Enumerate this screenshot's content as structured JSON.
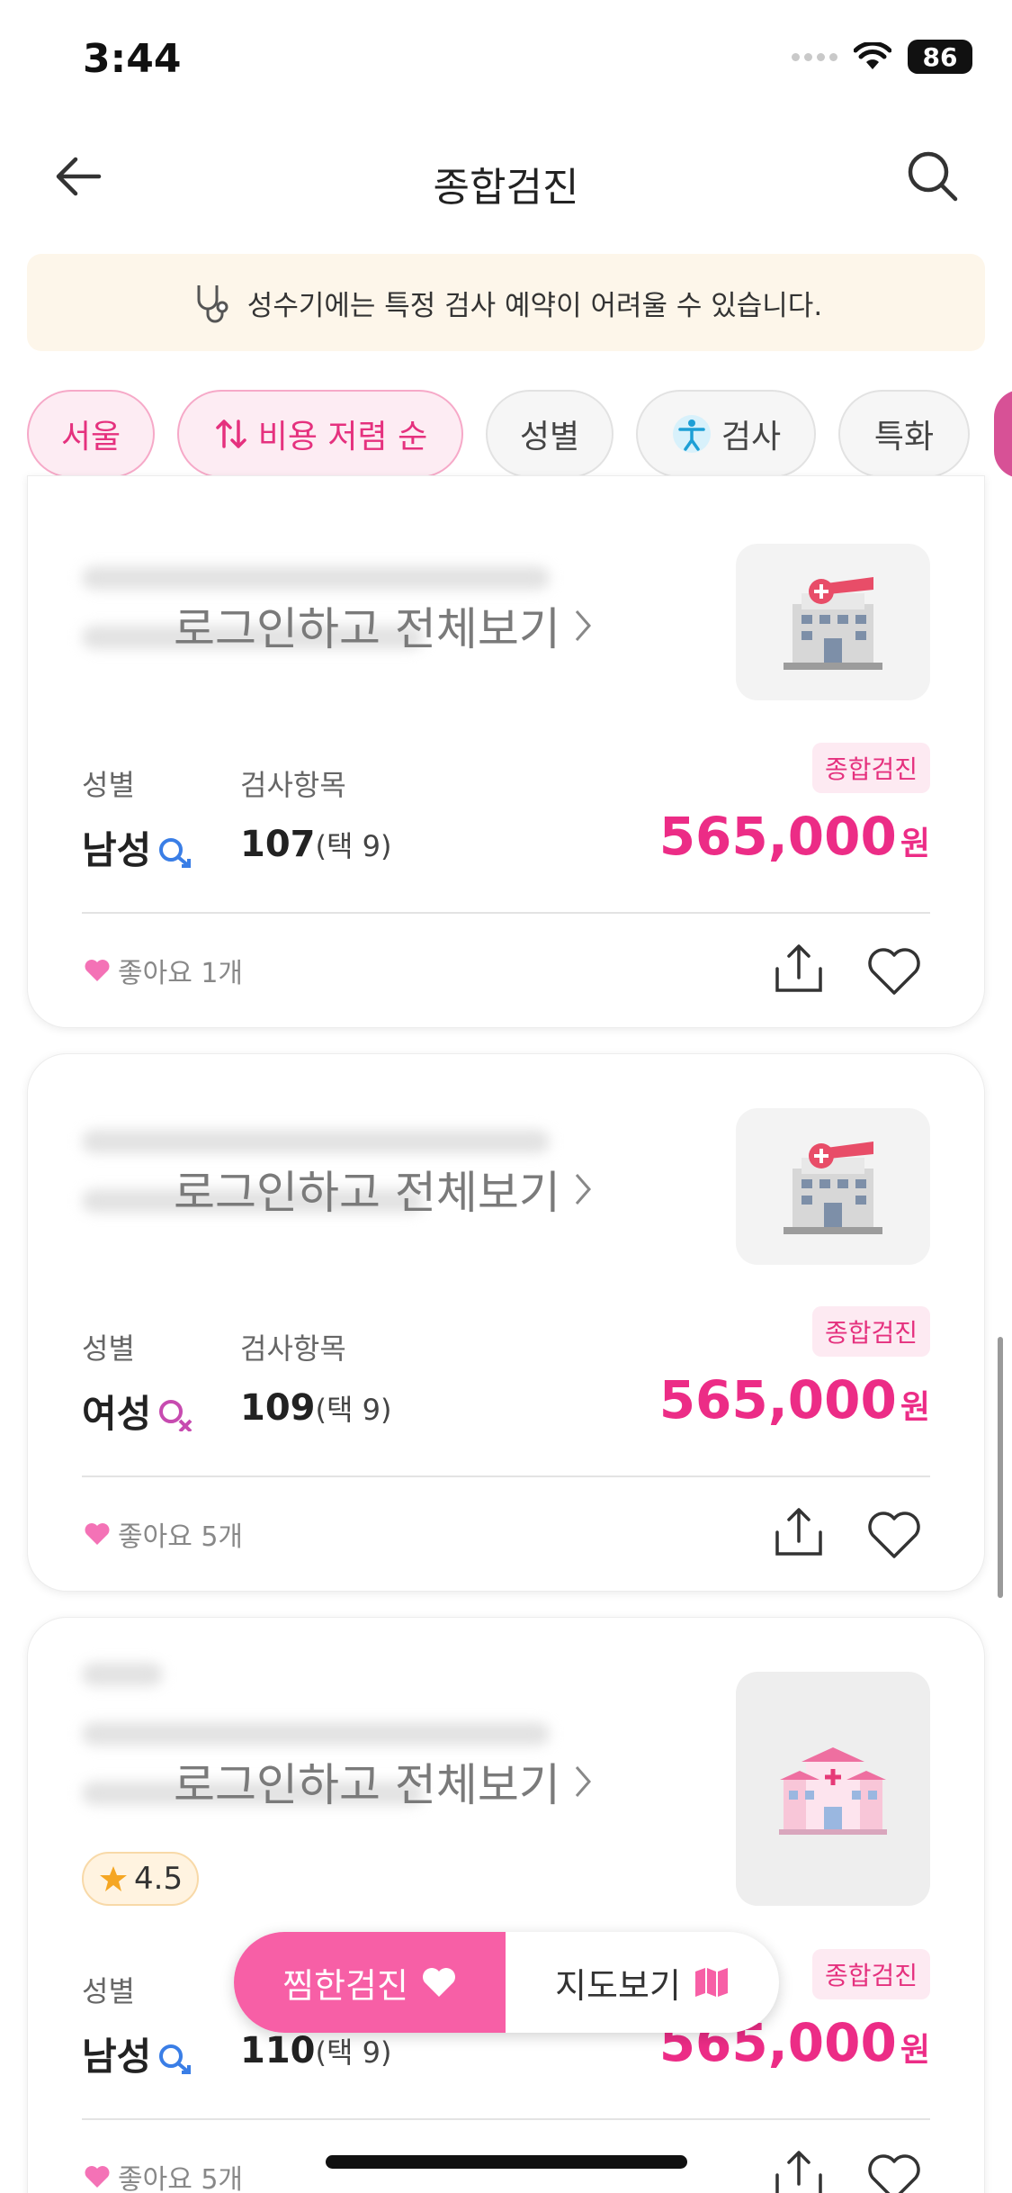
{
  "status": {
    "time": "3:44",
    "battery": "86"
  },
  "nav": {
    "title": "종합검진",
    "back_icon": "arrow-left-icon",
    "search_icon": "search-icon"
  },
  "notice": {
    "text": "성수기에는 특정 검사 예약이 어려울 수 있습니다.",
    "icon": "stethoscope-icon"
  },
  "filters": [
    {
      "label": "서울",
      "active": true
    },
    {
      "label": "비용 저렴 순",
      "active": true,
      "icon": "sort-arrows-icon"
    },
    {
      "label": "성별",
      "active": false
    },
    {
      "label": "검사",
      "active": false,
      "icon": "accessibility-icon"
    },
    {
      "label": "특화",
      "active": false
    }
  ],
  "cards": [
    {
      "login_text": "로그인하고 전체보기",
      "gender_label": "성별",
      "gender": "남성",
      "items_label": "검사항목",
      "items_count": "107",
      "items_select": "(택 9)",
      "tag": "종합검진",
      "price": "565,000",
      "currency": "원",
      "likes": "좋아요 1개"
    },
    {
      "login_text": "로그인하고 전체보기",
      "gender_label": "성별",
      "gender": "여성",
      "items_label": "검사항목",
      "items_count": "109",
      "items_select": "(택 9)",
      "tag": "종합검진",
      "price": "565,000",
      "currency": "원",
      "likes": "좋아요 5개"
    },
    {
      "login_text": "로그인하고 전체보기",
      "rating": "4.5",
      "gender_label": "성별",
      "gender": "남성",
      "items_count": "110",
      "items_select": "(택 9)",
      "tag": "종합검진",
      "price": "565,000",
      "currency": "원",
      "likes": "좋아요 5개"
    }
  ],
  "floating": {
    "wishlist_label": "찜한검진",
    "map_label": "지도보기"
  },
  "colors": {
    "accent": "#ec2c86",
    "pink_button": "#f75fa6",
    "notice_bg": "#fdf6ea"
  }
}
